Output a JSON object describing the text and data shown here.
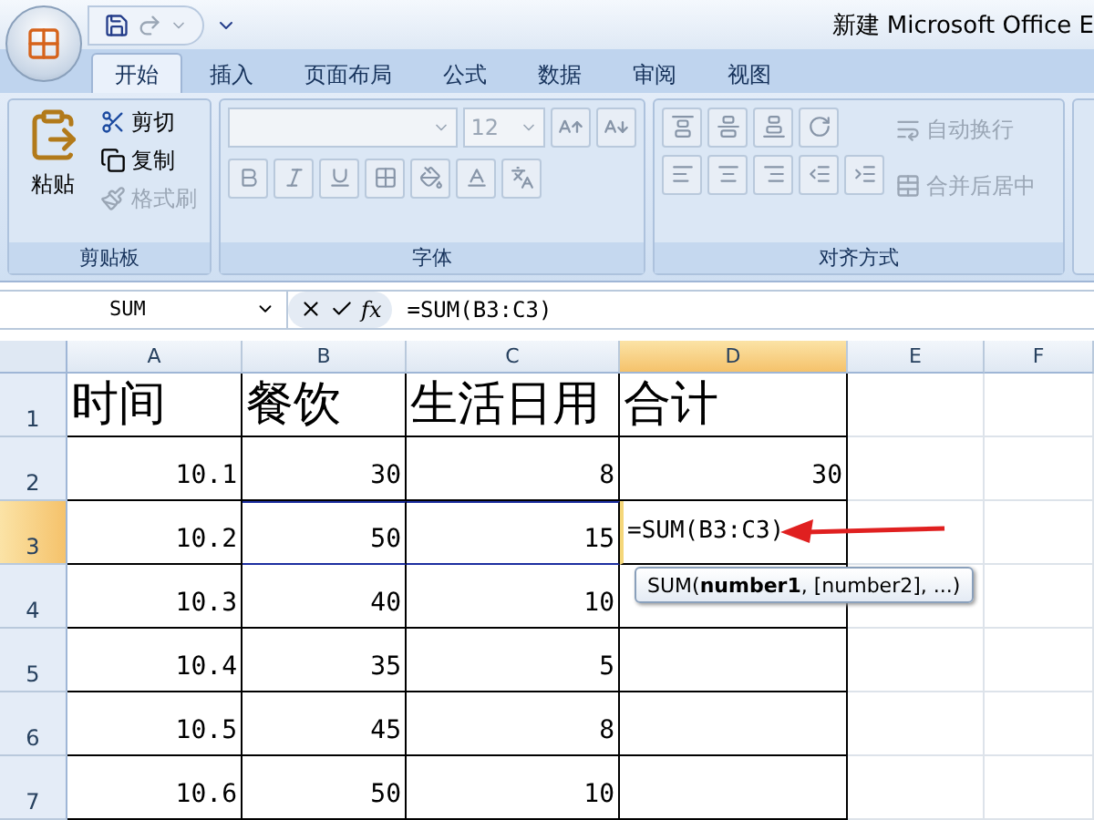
{
  "window": {
    "title": "新建 Microsoft Office E"
  },
  "tabs": [
    {
      "label": "开始",
      "selected": true
    },
    {
      "label": "插入",
      "selected": false
    },
    {
      "label": "页面布局",
      "selected": false
    },
    {
      "label": "公式",
      "selected": false
    },
    {
      "label": "数据",
      "selected": false
    },
    {
      "label": "审阅",
      "selected": false
    },
    {
      "label": "视图",
      "selected": false
    }
  ],
  "ribbon": {
    "clipboard": {
      "label": "剪贴板",
      "paste": "粘贴",
      "items": [
        {
          "kind": "cut",
          "label": "剪切",
          "disabled": false
        },
        {
          "kind": "copy",
          "label": "复制",
          "disabled": false
        },
        {
          "kind": "format",
          "label": "格式刷",
          "disabled": true
        }
      ]
    },
    "font": {
      "label": "字体",
      "font_size": "12"
    },
    "alignment": {
      "label": "对齐方式",
      "commands": [
        {
          "kind": "wrap",
          "label": "自动换行",
          "disabled": true
        },
        {
          "kind": "merge",
          "label": "合并后居中",
          "disabled": true
        }
      ]
    }
  },
  "formula_bar": {
    "name_box": "SUM",
    "function_button": "fx",
    "formula": "=SUM(B3:C3)"
  },
  "grid": {
    "columns": [
      {
        "label": "A",
        "selected": false
      },
      {
        "label": "B",
        "selected": false
      },
      {
        "label": "C",
        "selected": false
      },
      {
        "label": "D",
        "selected": true
      },
      {
        "label": "E",
        "selected": false
      },
      {
        "label": "F",
        "selected": false
      }
    ],
    "rows": [
      {
        "number": "1",
        "selected": false,
        "cells": [
          {
            "kind": "header",
            "text": "时间"
          },
          {
            "kind": "header",
            "text": "餐饮"
          },
          {
            "kind": "header",
            "text": "生活日用"
          },
          {
            "kind": "header",
            "text": "合计"
          }
        ]
      },
      {
        "number": "2",
        "selected": false,
        "cells": [
          {
            "kind": "number",
            "text": "10.1"
          },
          {
            "kind": "number",
            "text": "30"
          },
          {
            "kind": "number",
            "text": "8"
          },
          {
            "kind": "number",
            "text": "30"
          }
        ]
      },
      {
        "number": "3",
        "selected": true,
        "cells": [
          {
            "kind": "number",
            "text": "10.2"
          },
          {
            "kind": "number",
            "text": "50",
            "referenced": true
          },
          {
            "kind": "number",
            "text": "15",
            "referenced": true
          },
          {
            "kind": "formula",
            "text": "=SUM(B3:C3)"
          }
        ]
      },
      {
        "number": "4",
        "selected": false,
        "cells": [
          {
            "kind": "number",
            "text": "10.3"
          },
          {
            "kind": "number",
            "text": "40"
          },
          {
            "kind": "number",
            "text": "10"
          },
          {
            "kind": "empty"
          }
        ]
      },
      {
        "number": "5",
        "selected": false,
        "cells": [
          {
            "kind": "number",
            "text": "10.4"
          },
          {
            "kind": "number",
            "text": "35"
          },
          {
            "kind": "number",
            "text": "5"
          },
          {
            "kind": "empty"
          }
        ]
      },
      {
        "number": "6",
        "selected": false,
        "cells": [
          {
            "kind": "number",
            "text": "10.5"
          },
          {
            "kind": "number",
            "text": "45"
          },
          {
            "kind": "number",
            "text": "8"
          },
          {
            "kind": "empty"
          }
        ]
      },
      {
        "number": "7",
        "selected": false,
        "cells": [
          {
            "kind": "number",
            "text": "10.6"
          },
          {
            "kind": "number",
            "text": "50"
          },
          {
            "kind": "number",
            "text": "10"
          },
          {
            "kind": "empty"
          }
        ]
      }
    ]
  },
  "tooltip": "SUM(**number1**, [number2], ...)"
}
